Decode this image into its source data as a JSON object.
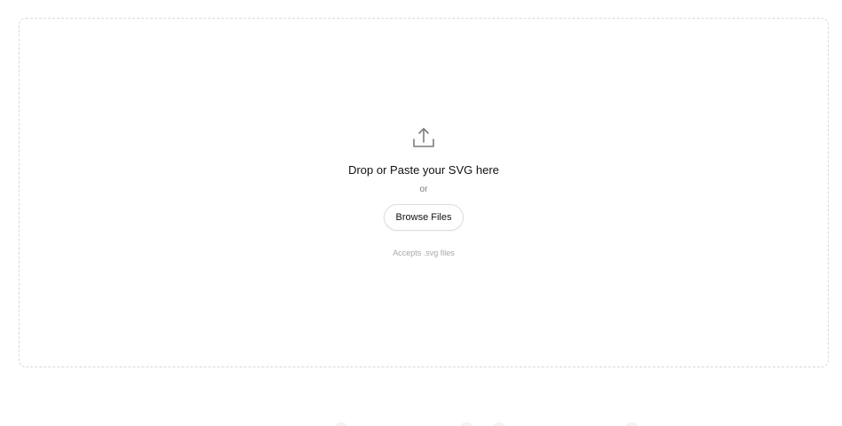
{
  "dropzone": {
    "icon": "upload-icon",
    "title": "Drop or Paste your SVG here",
    "or_text": "or",
    "browse_label": "Browse Files",
    "hint": "Accepts .svg files"
  },
  "colors": {
    "border": "#d9d9d9",
    "text": "#111111",
    "muted": "#7a7a7a",
    "hint": "#a8a8a8"
  }
}
